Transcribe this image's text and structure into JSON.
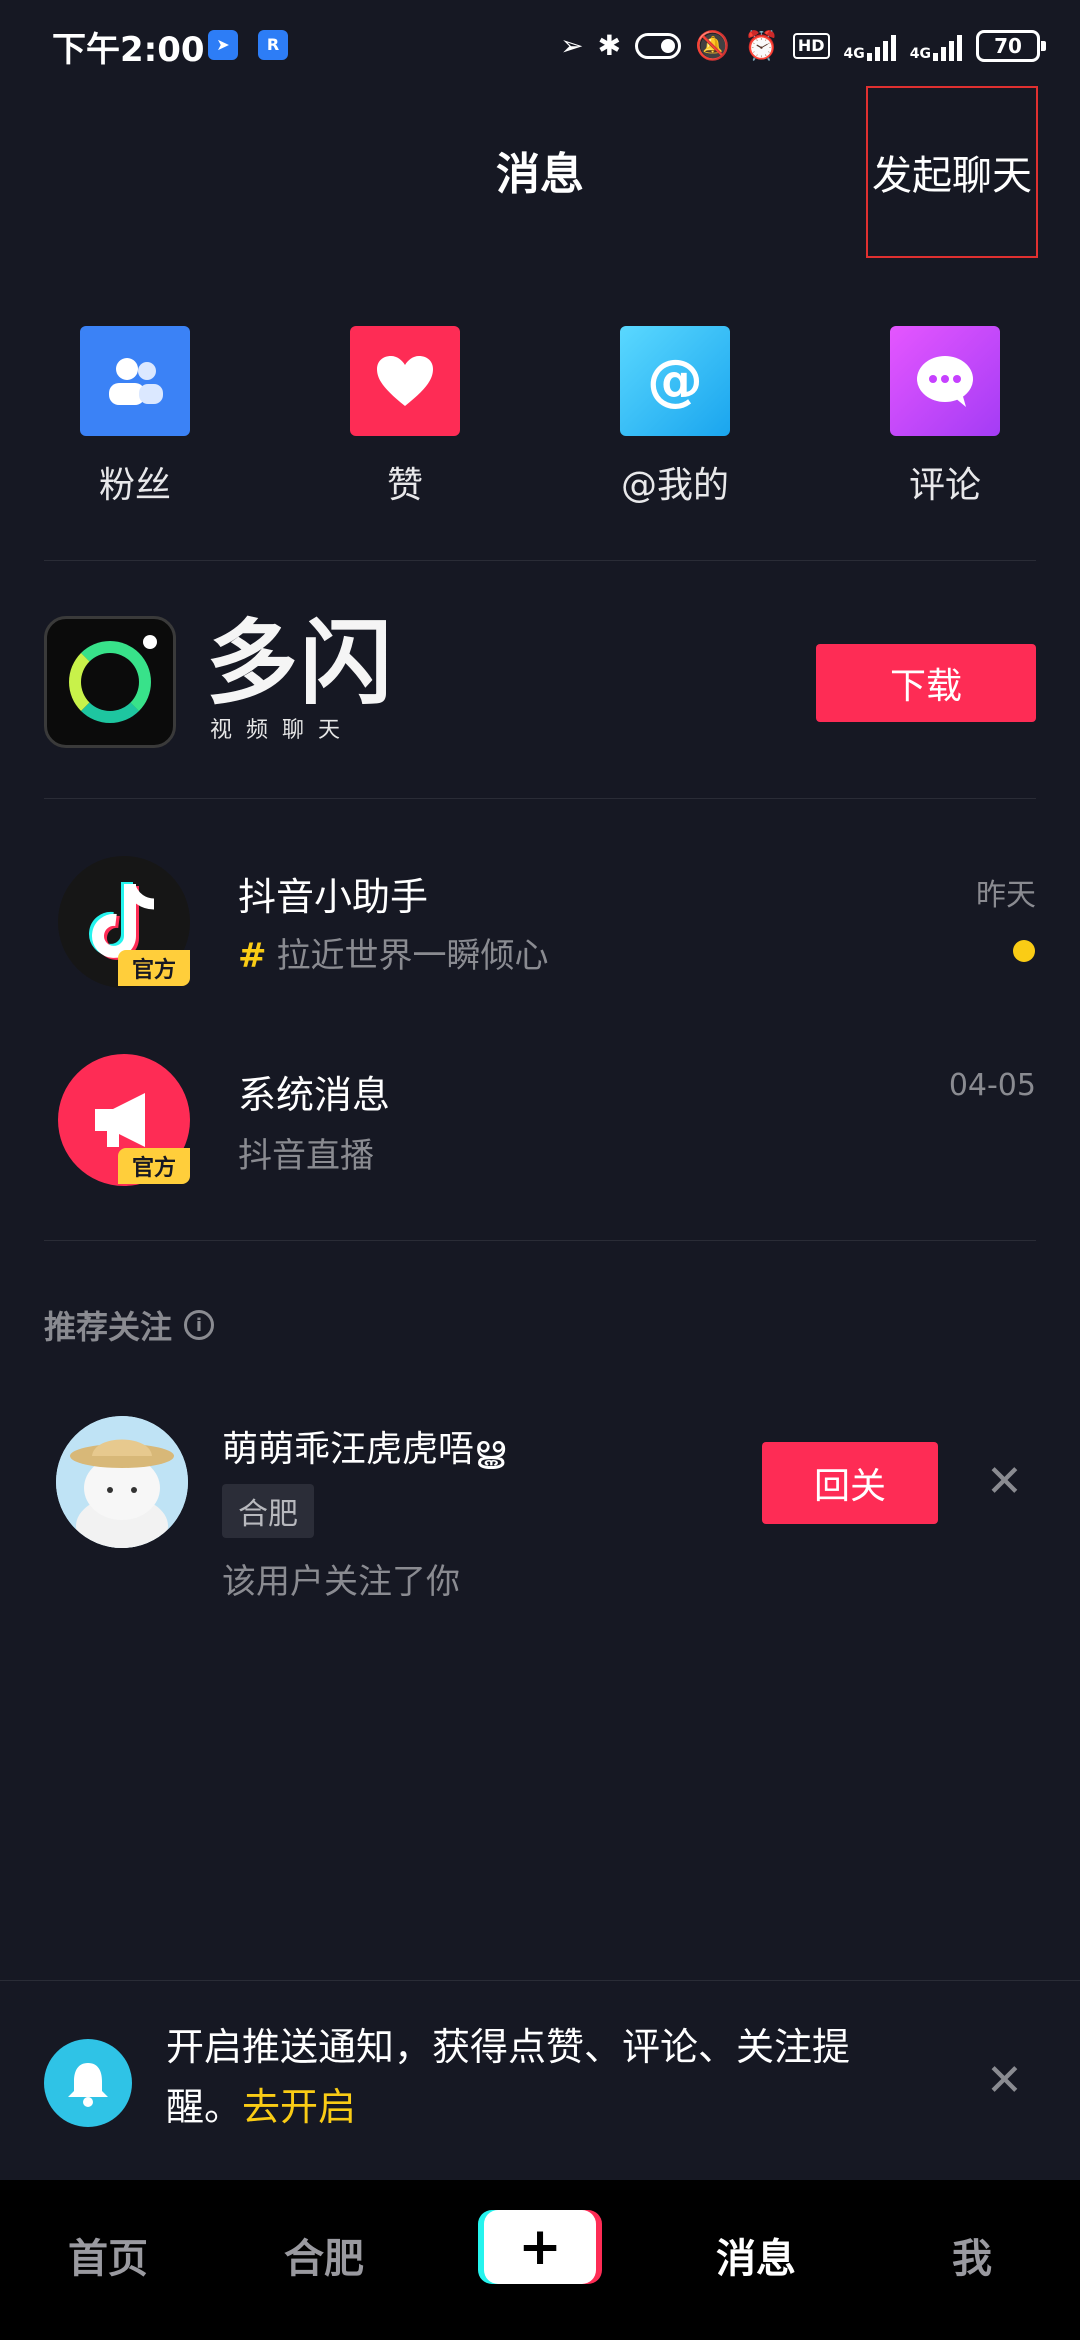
{
  "status_bar": {
    "time": "下午2:00",
    "network_1": "4G",
    "network_2": "4G",
    "hd": "HD",
    "battery": "70"
  },
  "header": {
    "title": "消息",
    "start_chat": "发起聊天"
  },
  "quick_entries": [
    {
      "label": "粉丝",
      "icon": "fans-icon",
      "color": "#3b82f6"
    },
    {
      "label": "赞",
      "icon": "heart-icon",
      "color": "#fe2c55"
    },
    {
      "label": "@我的",
      "icon": "at-icon",
      "color": "#22b8f0"
    },
    {
      "label": "评论",
      "icon": "comment-icon",
      "color": "#c640ff"
    }
  ],
  "promo": {
    "app_name": "多闪",
    "app_subtitle": "视频聊天",
    "download_label": "下载"
  },
  "conversations": [
    {
      "title": "抖音小助手",
      "subtitle": "拉近世界一瞬倾心",
      "time": "昨天",
      "badge": "官方",
      "unread": true
    },
    {
      "title": "系统消息",
      "subtitle": "抖音直播",
      "time": "04-05",
      "badge": "官方",
      "unread": false
    }
  ],
  "recommend": {
    "heading": "推荐关注",
    "user_name": "萌萌乖汪虎虎唔ൠ",
    "city": "合肥",
    "reason": "该用户关注了你",
    "follow_back": "回关"
  },
  "push_banner": {
    "text": "开启推送通知，获得点赞、评论、关注提醒。",
    "link": "去开启"
  },
  "tab_bar": {
    "home": "首页",
    "city": "合肥",
    "create": "+",
    "messages": "消息",
    "me": "我"
  },
  "colors": {
    "background": "#161823",
    "accent": "#fe2c55",
    "highlight": "#facc15"
  }
}
